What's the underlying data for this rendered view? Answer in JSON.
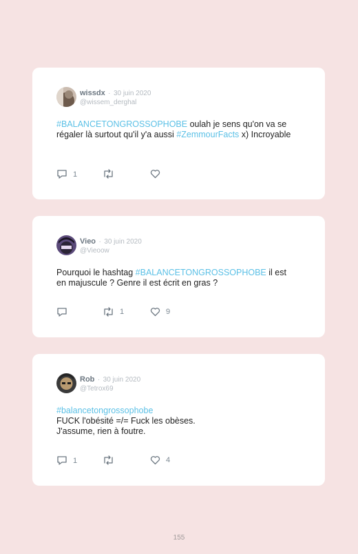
{
  "tweets": [
    {
      "name": "wissdx",
      "date": "30 juin 2020",
      "handle": "@wissem_derghal",
      "t1": "#BALANCETONGROSSOPHOBE",
      "t2": " oulah je sens qu'on va se régaler là surtout qu'il y'a aussi ",
      "t3": "#ZemmourFacts",
      "t4": " x) Incroyable",
      "replies": "1",
      "retweets": "",
      "likes": ""
    },
    {
      "name": "Vieo",
      "date": "30 juin 2020",
      "handle": "@Vieoow",
      "t1": "Pourquoi le hashtag ",
      "t2": "#BALANCETONGROSSOPHOBE",
      "t3": " il est en majuscule ? Genre il est écrit en gras ?",
      "replies": "",
      "retweets": "1",
      "likes": "9"
    },
    {
      "name": "Rob",
      "date": "30 juin 2020",
      "handle": "@Tetrox69",
      "t1": "#balancetongrossophobe",
      "line2": "FUCK l'obésité =/= Fuck les obèses.",
      "line3": "J'assume, rien à foutre.",
      "replies": "1",
      "retweets": "",
      "likes": "4"
    }
  ],
  "dot": "·",
  "page_number": "155",
  "colors": {
    "background": "#f6e3e3",
    "hashtag": "#5bc0e6",
    "muted": "#b4bac0",
    "name": "#6b7680"
  },
  "icons": [
    "reply-icon",
    "retweet-icon",
    "like-icon"
  ]
}
